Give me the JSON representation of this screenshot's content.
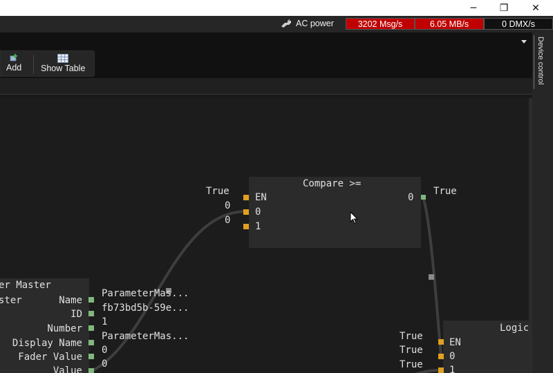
{
  "window": {
    "minimize": "─",
    "maximize": "❐",
    "close": "✕"
  },
  "status": {
    "power_label": "AC power",
    "msg_rate": "3202 Msg/s",
    "data_rate": "6.05 MB/s",
    "dmx_rate": "0 DMX/s",
    "colors": {
      "alert": "#c00000",
      "normal": "#111111"
    }
  },
  "toolbar": {
    "add_label": "Add",
    "show_table_label": "Show Table"
  },
  "side_panel": {
    "tab_label": "Device control"
  },
  "nodes": {
    "compare": {
      "title": "Compare >=",
      "inputs": [
        {
          "label": "EN",
          "value": "True"
        },
        {
          "label": "0",
          "value": "0"
        },
        {
          "label": "1",
          "value": "0"
        }
      ],
      "output": {
        "label": "0",
        "value": "True"
      }
    },
    "fader_master": {
      "title": "er Master",
      "subtitle": "ster",
      "outputs": [
        {
          "label": "Name",
          "value": "ParameterMas..."
        },
        {
          "label": "ID",
          "value": "fb73bd5b-59e..."
        },
        {
          "label": "Number",
          "value": "1"
        },
        {
          "label": "Display Name",
          "value": "ParameterMas..."
        },
        {
          "label": "Fader Value",
          "value": "0"
        },
        {
          "label": "Value",
          "value": "0"
        }
      ]
    },
    "logic": {
      "title": "Logic",
      "inputs": [
        {
          "label": "EN",
          "value": "True"
        },
        {
          "label": "0",
          "value": "True"
        },
        {
          "label": "1",
          "value": "True"
        }
      ]
    }
  }
}
